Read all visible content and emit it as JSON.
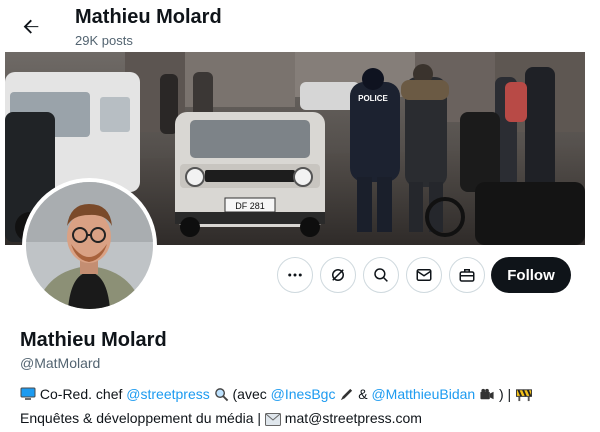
{
  "header": {
    "name": "Mathieu Molard",
    "posts": "29K posts"
  },
  "banner": {
    "police_text": "POLICE",
    "plate_text": "DF 281"
  },
  "actions": {
    "follow_label": "Follow"
  },
  "profile": {
    "name": "Mathieu Molard",
    "handle": "@MatMolard"
  },
  "bio": {
    "line1_part1": "Co-Red. chef ",
    "mention_streetpress": "@streetpress",
    "line1_part2": " (avec ",
    "mention_ines": "@InesBgc",
    "line1_part3": " & ",
    "mention_matthieu": "@MatthieuBidan",
    "line1_part4": " ) | ",
    "line2_part1": "Enquêtes & développement du média  | ",
    "line2_part2": " mat@streetpress.com"
  },
  "colors": {
    "accent": "#1d9bf0",
    "follow_bg": "#0f1419",
    "secondary_text": "#536471"
  }
}
